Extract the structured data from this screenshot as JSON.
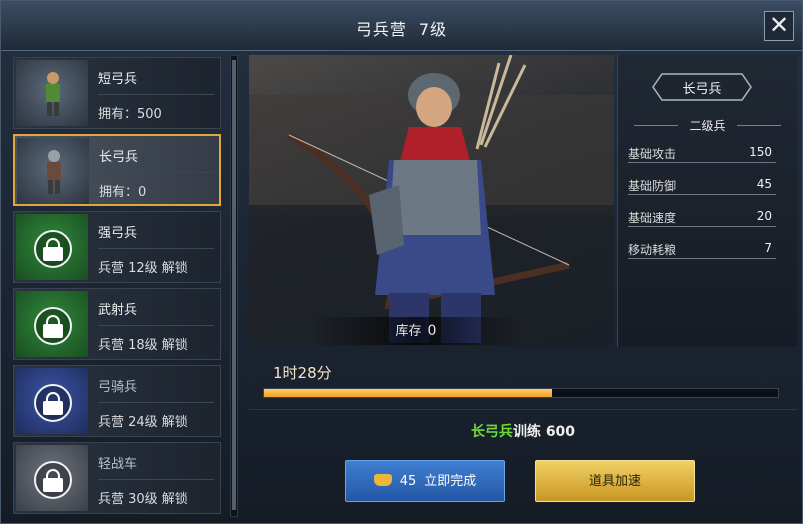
{
  "window": {
    "title": "弓兵营",
    "level": "7级",
    "close_label": "✕"
  },
  "units": [
    {
      "name": "短弓兵",
      "sub": "拥有：500"
    },
    {
      "name": "长弓兵",
      "sub": "拥有：0"
    },
    {
      "name": "强弓兵",
      "sub": "兵营 12级 解锁"
    },
    {
      "name": "武射兵",
      "sub": "兵营 18级 解锁"
    },
    {
      "name": "弓骑兵",
      "sub": "兵营 24级 解锁"
    },
    {
      "name": "轻战车",
      "sub": "兵营 30级 解锁"
    }
  ],
  "selected_unit": {
    "name": "长弓兵",
    "tier": "二级兵",
    "stock_label": "库存",
    "stock_value": "0",
    "stats": [
      {
        "label": "基础攻击",
        "value": "150"
      },
      {
        "label": "基础防御",
        "value": "45"
      },
      {
        "label": "基础速度",
        "value": "20"
      },
      {
        "label": "移动耗粮",
        "value": "7"
      }
    ]
  },
  "training": {
    "time_left": "1时28分",
    "progress": 0.56,
    "unit_name": "长弓兵",
    "action_label": "训练",
    "count": "600"
  },
  "buttons": {
    "instant_cost": "45",
    "instant_label": "立即完成",
    "speedup_label": "道具加速"
  },
  "colors": {
    "accent_gold": "#e0a83a",
    "progress": "#f0a028",
    "unit_highlight": "#6edb3b",
    "instant_button": "#2f6bbd",
    "speedup_button": "#dcb23a"
  }
}
